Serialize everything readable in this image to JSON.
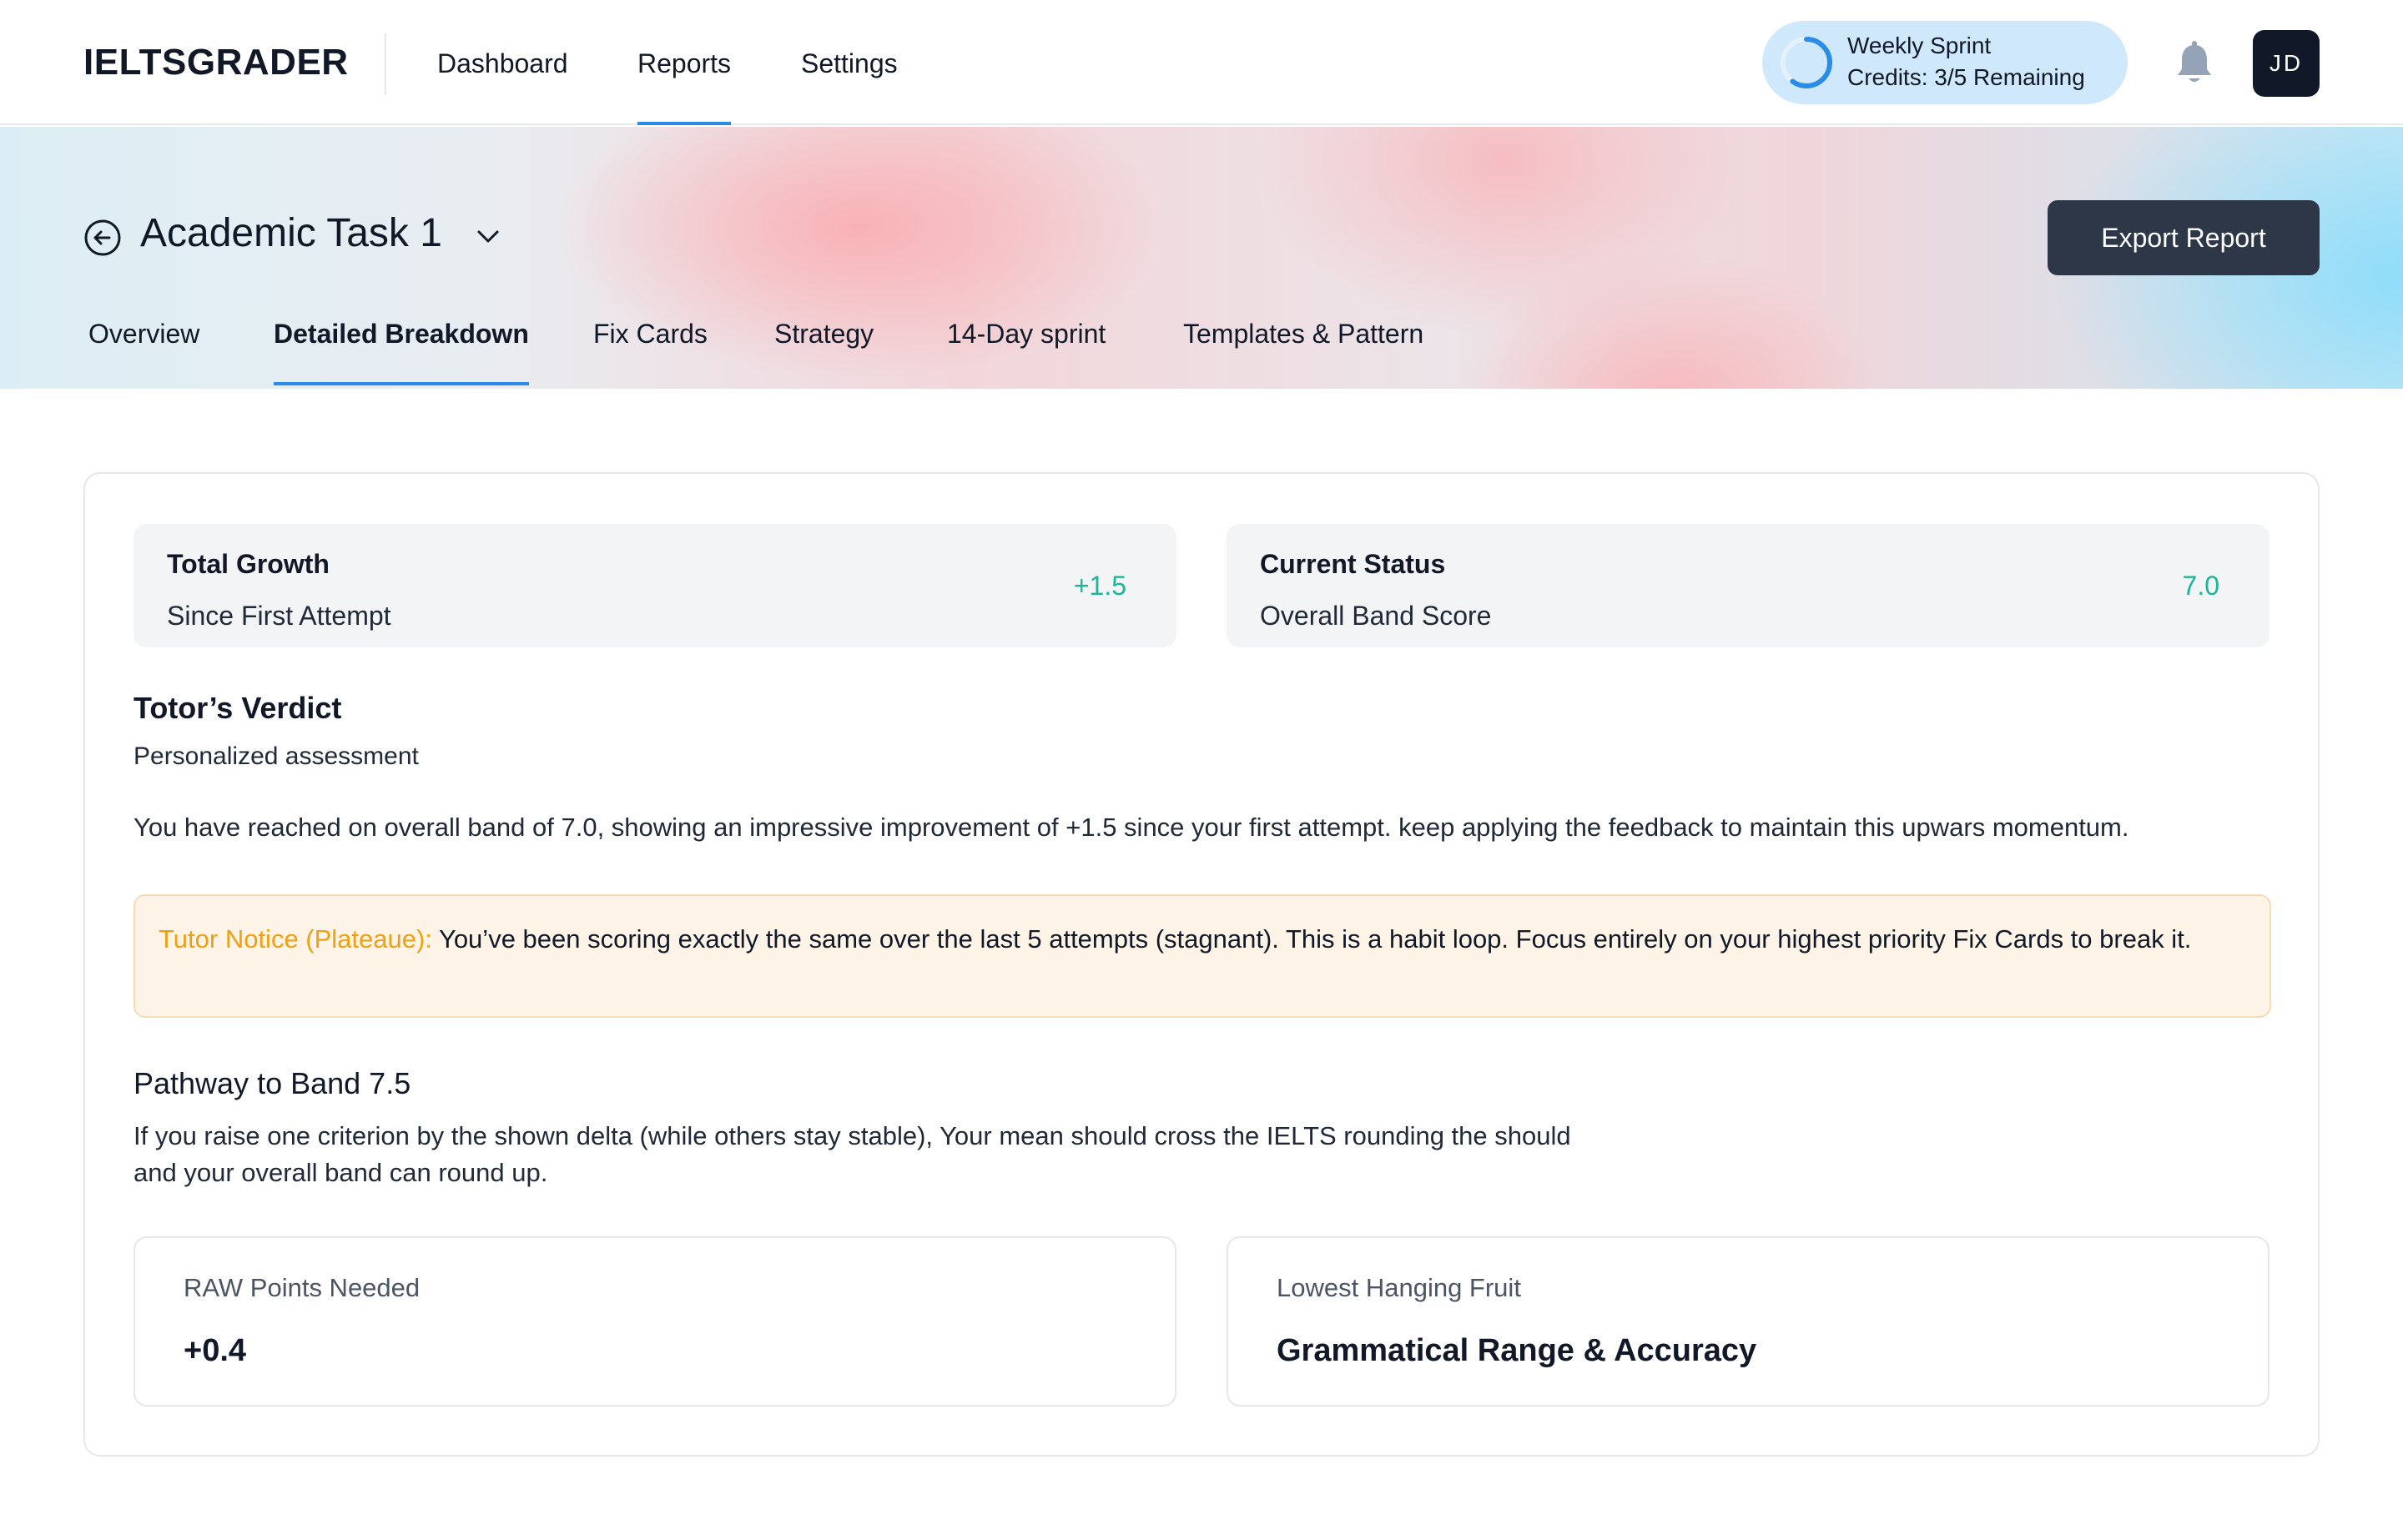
{
  "nav": {
    "brand": "IELTSGRADER",
    "links": [
      {
        "label": "Dashboard",
        "active": false
      },
      {
        "label": "Reports",
        "active": true
      },
      {
        "label": "Settings",
        "active": false
      }
    ],
    "sprint": {
      "title": "Weekly Sprint",
      "credits": "Credits: 3/5 Remaining",
      "progress": 0.6
    },
    "avatar_initials": "JD"
  },
  "header": {
    "task_title": "Academic Task 1",
    "export_label": "Export Report",
    "tabs": [
      {
        "label": "Overview",
        "active": false
      },
      {
        "label": "Detailed Breakdown",
        "active": true
      },
      {
        "label": "Fix Cards",
        "active": false
      },
      {
        "label": "Strategy",
        "active": false
      },
      {
        "label": "14-Day sprint",
        "active": false
      },
      {
        "label": "Templates & Pattern",
        "active": false
      }
    ]
  },
  "stats": {
    "growth": {
      "title": "Total Growth",
      "subtitle": "Since First Attempt",
      "value": "+1.5"
    },
    "status": {
      "title": "Current Status",
      "subtitle": "Overall Band Score",
      "value": "7.0"
    }
  },
  "verdict": {
    "title": "Totor’s Verdict",
    "subtitle": "Personalized assessment",
    "body": "You have reached on overall band of 7.0, showing an impressive improvement of +1.5 since your first attempt. keep applying the feedback to maintain this upwars momentum."
  },
  "notice": {
    "label": "Tutor Notice (Plateaue):",
    "text": " You’ve been scoring exactly the same over the last 5 attempts (stagnant). This is a habit loop. Focus entirely on your highest priority Fix Cards to break it."
  },
  "pathway": {
    "title": "Pathway to Band 7.5",
    "description": "If you raise one criterion by the shown delta (while others stay stable), Your mean should cross the IELTS rounding the should and your overall band can round up."
  },
  "metrics": {
    "raw_points": {
      "label": "RAW Points Needed",
      "value": "+0.4"
    },
    "lowest_fruit": {
      "label": "Lowest Hanging Fruit",
      "value": "Grammatical Range & Accuracy"
    }
  },
  "colors": {
    "accent": "#2b8ce6",
    "positive": "#1db597",
    "notice_label": "#f0a014",
    "button_dark": "#2d3748"
  }
}
